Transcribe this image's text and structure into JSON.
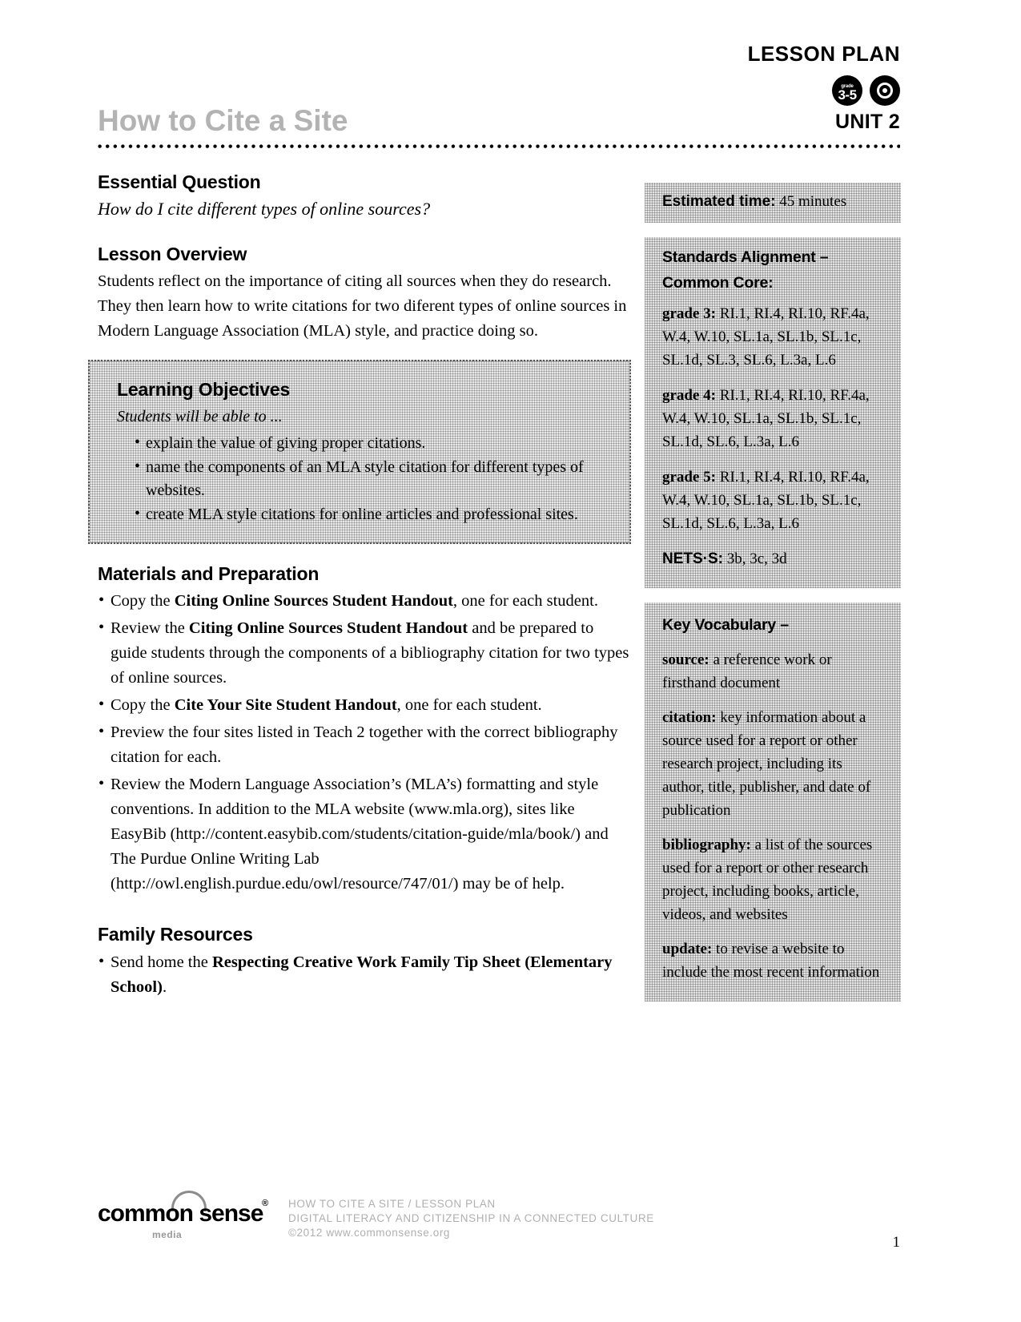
{
  "header": {
    "lesson_plan_label": "LESSON PLAN",
    "title": "How to Cite a Site",
    "unit_label": "UNIT 2",
    "grade_badge": {
      "word": "grade",
      "range": "3-5"
    },
    "unit_badge_icon": "target-circle-icon"
  },
  "essential_question": {
    "heading": "Essential Question",
    "text": "How do I cite different types of online sources?"
  },
  "lesson_overview": {
    "heading": "Lesson Overview",
    "text": "Students reflect on the importance of citing all sources when they do research. They then learn how to write citations for  two diferent types of online sources in Modern Language Association (MLA) style, and practice doing so."
  },
  "learning_objectives": {
    "heading": "Learning Objectives",
    "intro": "Students will be able to ...",
    "items": [
      "explain the value of giving proper citations.",
      "name the components of an MLA style citation for different types of websites.",
      "create MLA style citations for online articles and professional sites."
    ]
  },
  "materials": {
    "heading": "Materials and Preparation",
    "items": [
      {
        "pre": "Copy the ",
        "bold": "Citing Online Sources Student Handout",
        "post": ", one for each student."
      },
      {
        "pre": "Review the ",
        "bold": "Citing Online Sources Student Handout",
        "post": " and be prepared to guide students through the components of a bibliography citation for two types of online sources."
      },
      {
        "pre": "Copy the ",
        "bold": "Cite Your Site Student Handout",
        "post": ", one for each student."
      },
      {
        "pre": "Preview the four sites listed in Teach 2 together with the correct bibliography citation for each.",
        "bold": "",
        "post": ""
      },
      {
        "pre": "Review the Modern Language Association’s (MLA’s) formatting and style conventions. In addition to the MLA website (www.mla.org), sites like EasyBib (http://content.easybib.com/students/citation-guide/mla/book/) and The Purdue Online Writing Lab (http://owl.english.purdue.edu/owl/resource/747/01/) may be of help.",
        "bold": "",
        "post": ""
      }
    ]
  },
  "family_resources": {
    "heading": "Family Resources",
    "items": [
      {
        "pre": "Send home the ",
        "bold": "Respecting Creative Work Family Tip Sheet (Elementary School)",
        "post": "."
      }
    ]
  },
  "sidebar": {
    "estimated_time": {
      "label": "Estimated time:",
      "value": "45 minutes"
    },
    "standards": {
      "heading": "Standards Alignment –",
      "subheading": "Common Core:",
      "grades": [
        {
          "label": "grade 3:",
          "value": "RI.1, RI.4, RI.10, RF.4a, W.4, W.10, SL.1a, SL.1b, SL.1c, SL.1d, SL.3, SL.6, L.3a, L.6"
        },
        {
          "label": "grade 4:",
          "value": "RI.1, RI.4, RI.10, RF.4a, W.4, W.10, SL.1a, SL.1b, SL.1c, SL.1d, SL.6, L.3a, L.6"
        },
        {
          "label": "grade 5:",
          "value": "RI.1, RI.4, RI.10, RF.4a, W.4, W.10, SL.1a, SL.1b, SL.1c, SL.1d, SL.6, L.3a, L.6"
        }
      ],
      "nets": {
        "label": "NETS·S:",
        "value": "3b, 3c, 3d"
      }
    },
    "vocabulary": {
      "heading": "Key Vocabulary –",
      "entries": [
        {
          "term": "source:",
          "definition": " a reference work or firsthand document"
        },
        {
          "term": "citation:",
          "definition": " key information about a source used for a report or other research project, including its author, title, publisher, and date of publication"
        },
        {
          "term": "bibliography:",
          "definition": " a list of the sources used for a report or other research project, including books, article, videos, and websites"
        },
        {
          "term": "update:",
          "definition": " to revise a website to include the most recent information"
        }
      ]
    }
  },
  "footer": {
    "logo_word": "common sense",
    "logo_tm": "®",
    "logo_sub": "media",
    "meta_line1": "HOW TO CITE A SITE / LESSON PLAN",
    "meta_line2": "DIGITAL LITERACY AND CITIZENSHIP IN A CONNECTED CULTURE",
    "meta_line3": "©2012 www.commonsense.org",
    "page_number": "1"
  },
  "colors": {
    "title_gray": "#b3b3b3",
    "shade_gray": "#e4e4e4",
    "footer_gray": "#b0b0b0"
  }
}
